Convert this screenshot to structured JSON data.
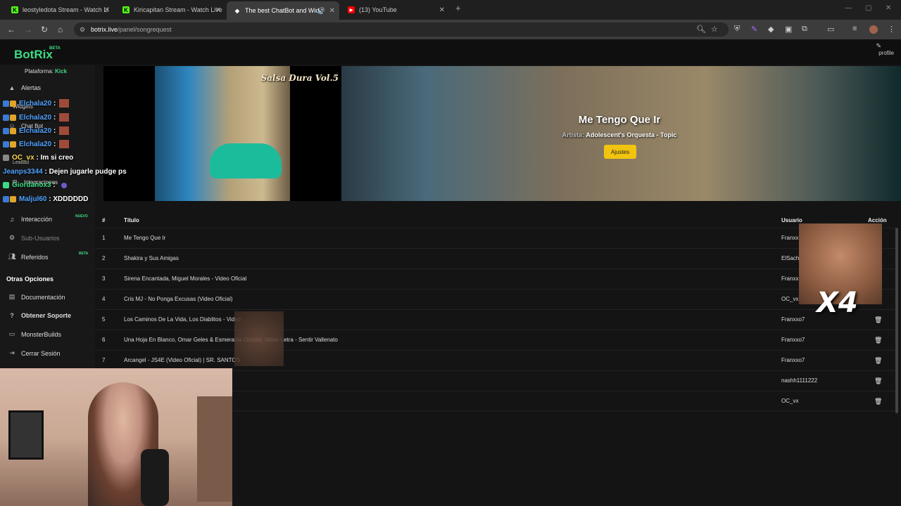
{
  "browser": {
    "tabs": [
      {
        "title": "leostyledota Stream - Watch Li",
        "fav": "K"
      },
      {
        "title": "Kiricapitan Stream - Watch Live",
        "fav": "K"
      },
      {
        "title": "The best ChatBot and Widg",
        "fav": "◆"
      },
      {
        "title": "(13) YouTube",
        "fav": "▶"
      }
    ],
    "url_host": "botrix.live",
    "url_path": "/panel/songrequest"
  },
  "app": {
    "logo": "BotRix",
    "beta": "BETA",
    "profile": "profile"
  },
  "sidebar": {
    "platform_label": "Plataforma:",
    "platform_value": "Kick",
    "items": [
      {
        "label": "Alertas"
      },
      {
        "label": "Widgets"
      },
      {
        "label": "Chat Bot"
      },
      {
        "label": "Lealtad"
      },
      {
        "label": "Integraciones"
      },
      {
        "label": "Interacción"
      },
      {
        "label": "Sub-Usuarios"
      },
      {
        "label": "Referidos"
      }
    ],
    "new_badge": "NUEVO",
    "beta_badge": "BETA",
    "other_title": "Otras Opciones",
    "other_items": [
      {
        "label": "Documentación"
      },
      {
        "label": "Obtener Soporte"
      },
      {
        "label": "MonsterBuilds"
      },
      {
        "label": "Cerrar Sesión"
      }
    ]
  },
  "chat": [
    {
      "user": "Elchala20",
      "msg": ":"
    },
    {
      "user": "Elchala20",
      "msg": ":"
    },
    {
      "user": "Elchala20",
      "msg": ":"
    },
    {
      "user": "Elchala20",
      "msg": ":"
    },
    {
      "user": "OC_vx",
      "msg": ": Im si creo"
    },
    {
      "user": "Jeanps3344",
      "msg": ": Dejen jugarle pudge ps"
    },
    {
      "user": "Giordanox3",
      "msg": ":"
    },
    {
      "user": "Maljul60",
      "msg": ": XDDDDDD"
    }
  ],
  "player": {
    "cover_title": "Salsa Dura Vol.5",
    "song_title": "Me Tengo Que Ir",
    "artist_label": "Artista:",
    "artist": "Adolescent's Orquesta - Topic",
    "settings_button": "Ajustes"
  },
  "table": {
    "headers": {
      "num": "#",
      "title": "Título",
      "user": "Usuario",
      "action": "Acción"
    },
    "rows": [
      {
        "num": "1",
        "title": "Me Tengo Que Ir",
        "user": "Franxx"
      },
      {
        "num": "2",
        "title": "Shakira y Sus Amigas",
        "user": "ElSach"
      },
      {
        "num": "3",
        "title": "Sirena Encantada, Miguel Morales - Video Oficial",
        "user": "Franxx"
      },
      {
        "num": "4",
        "title": "Cris MJ - No Ponga Excusas (Video Oficial)",
        "user": "OC_vx"
      },
      {
        "num": "5",
        "title": "Los Caminos De La Vida, Los Diablitos - Video",
        "user": "Franxxo7"
      },
      {
        "num": "6",
        "title": "Una Hoja En Blanco, Omar Geles & Esmeralda Orozco, Video Letra - Sentir Vallenato",
        "user": "Franxxo7"
      },
      {
        "num": "7",
        "title": "Arcangel - JS4E (Video Oficial) | SR. SANTOS",
        "user": "Franxxo7"
      },
      {
        "num": "",
        "title": "",
        "user": "nashh1111222"
      },
      {
        "num": "",
        "title": "",
        "user": "OC_vx"
      }
    ]
  },
  "overlay": {
    "meme_text": "X4"
  }
}
